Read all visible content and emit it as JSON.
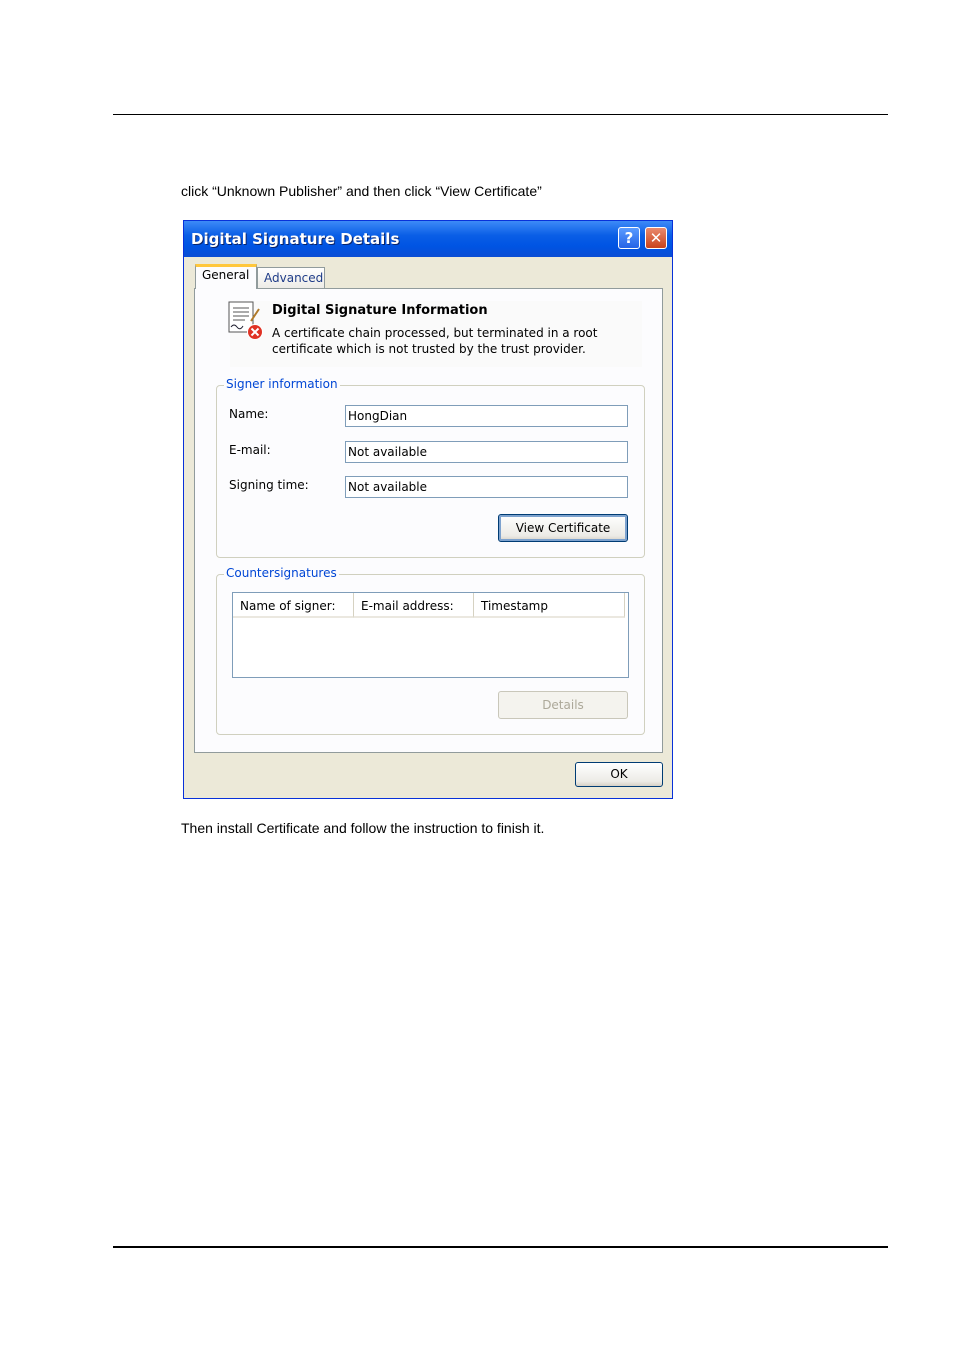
{
  "document": {
    "instruction_top": "click “Unknown Publisher” and then click “View Certificate”",
    "instruction_bottom": "Then install Certificate and follow the instruction to finish it."
  },
  "dialog": {
    "title": "Digital Signature Details",
    "help_glyph": "?",
    "close_glyph": "✕",
    "tabs": [
      {
        "label": "General",
        "active": true
      },
      {
        "label": "Advanced",
        "active": false
      }
    ],
    "info": {
      "title": "Digital Signature Information",
      "message": "A certificate chain processed, but terminated in a root certificate which is not trusted by the trust provider.",
      "icon": "certificate-error-icon"
    },
    "signer": {
      "group_label": "Signer information",
      "name_label": "Name:",
      "name_value": "HongDian",
      "email_label": "E-mail:",
      "email_value": "Not available",
      "time_label": "Signing time:",
      "time_value": "Not available",
      "view_certificate_label": "View Certificate"
    },
    "countersignatures": {
      "group_label": "Countersignatures",
      "columns": [
        "Name of signer:",
        "E-mail address:",
        "Timestamp"
      ],
      "details_label": "Details"
    },
    "ok_label": "OK"
  },
  "colors": {
    "titlebar": "#0054e3",
    "dialog_bg": "#ece9d8",
    "group_label": "#0046d5",
    "tab_highlight": "#ffc73c"
  }
}
